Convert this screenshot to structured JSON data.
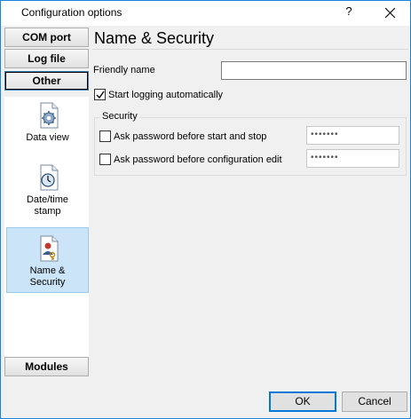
{
  "window": {
    "title": "Configuration options",
    "help_glyph": "?"
  },
  "sidebar": {
    "tabs": [
      {
        "label": "COM port",
        "active": false
      },
      {
        "label": "Log file",
        "active": false
      },
      {
        "label": "Other",
        "active": true
      }
    ],
    "items": [
      {
        "label": "Data view",
        "icon": "gear-document-icon",
        "selected": false
      },
      {
        "label": "Date/time stamp",
        "icon": "clock-document-icon",
        "selected": false
      },
      {
        "label": "Name & Security",
        "icon": "person-key-document-icon",
        "selected": true
      }
    ],
    "modules_label": "Modules"
  },
  "panel": {
    "title": "Name & Security",
    "friendly_name": {
      "label": "Friendly name",
      "value": ""
    },
    "start_logging": {
      "label": "Start logging automatically",
      "checked": true
    },
    "security": {
      "legend": "Security",
      "ask_start_stop": {
        "label": "Ask password before start and stop",
        "checked": false,
        "password_mask": "•••••••"
      },
      "ask_config_edit": {
        "label": "Ask password before configuration edit",
        "checked": false,
        "password_mask": "•••••••"
      }
    }
  },
  "footer": {
    "ok_label": "OK",
    "cancel_label": "Cancel"
  },
  "colors": {
    "window_border": "#1883d7",
    "selection_bg": "#cce4f7",
    "default_button_border": "#0078d7"
  }
}
